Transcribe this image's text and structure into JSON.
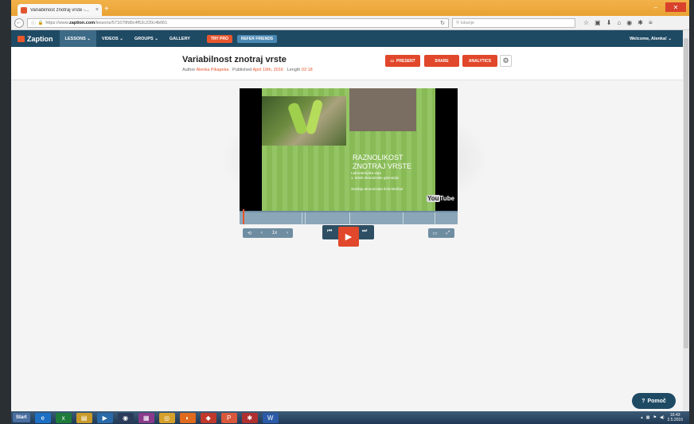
{
  "browser": {
    "tab_title": "Variabilnost znotraj vrste -...",
    "tab_close": "×",
    "new_tab": "+",
    "url_prefix": "https://www.",
    "url_domain": "zaption.com",
    "url_path": "/lessons/571679fd0c4f52c220c4b061",
    "search_placeholder": "Iskanje",
    "min_label": "–",
    "close_label": "✕"
  },
  "app": {
    "logo": "Zaption",
    "menu": [
      {
        "label": "LESSONS ⌄"
      },
      {
        "label": "VIDEOS ⌄"
      },
      {
        "label": "GROUPS ⌄"
      },
      {
        "label": "GALLERY"
      }
    ],
    "try_pro": "TRY PRO",
    "refer_friends": "REFER FRIENDS",
    "welcome": "Welcome, Alenka! ⌄"
  },
  "lesson": {
    "title": "Variabilnost znotraj vrste",
    "author_label": "Author",
    "author": "Alenka Pikapeka",
    "published_label": "Published",
    "published": "April 19th, 2016",
    "length_label": "Length",
    "length": "02:18",
    "present": "PRESENT",
    "share": "SHARE",
    "analytics": "ANALYTICS"
  },
  "slide": {
    "heading_line1": "RAZNOLIKOST",
    "heading_line2": "ZNOTRAJ VRSTE",
    "sub_line1": "Laboratorijska vaja",
    "sub_line2": "1. letnik ekonomske gimnazije",
    "sub_line3": "Srednja ekonomska šola Maribor",
    "youtube": "You"
  },
  "controls": {
    "speed": "1x"
  },
  "help": {
    "label": "Pomoč"
  },
  "taskbar": {
    "start": "Start",
    "time": "16:43",
    "date": "2.5.2016"
  }
}
